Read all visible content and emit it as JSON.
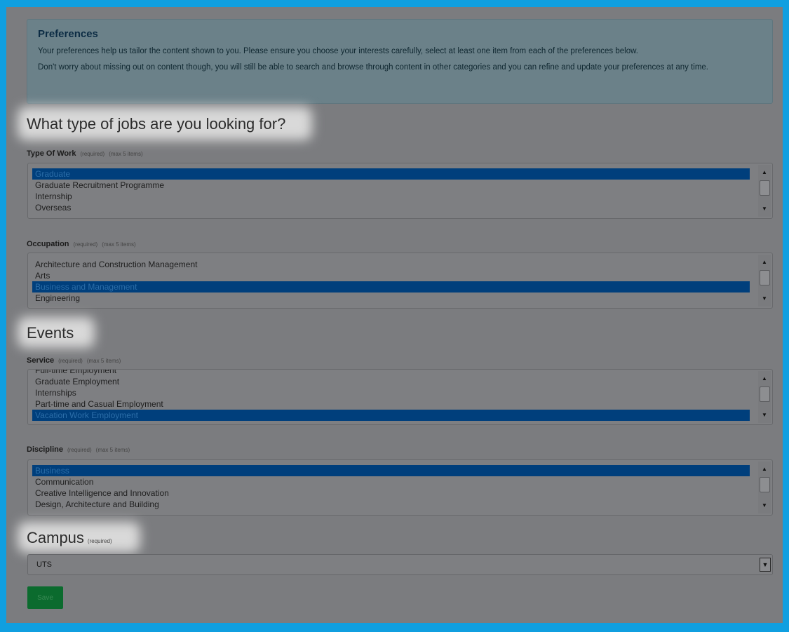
{
  "preferences": {
    "title": "Preferences",
    "line1": "Your preferences help us tailor the content shown to you. Please ensure you choose your interests carefully, select at least one item from each of the preferences below.",
    "line2": "Don't worry about missing out on content though, you will still be able to search and browse through content in other categories and you can refine and update your preferences at any time."
  },
  "jobs": {
    "heading": "What type of jobs are you looking for?",
    "type_of_work": {
      "label": "Type Of Work",
      "required": "(required)",
      "max": "(max 5 items)",
      "options": [
        "Graduate",
        "Graduate Recruitment Programme",
        "Internship",
        "Overseas"
      ],
      "selected": [
        0
      ]
    },
    "occupation": {
      "label": "Occupation",
      "required": "(required)",
      "max": "(max 5 items)",
      "options": [
        "Architecture and Construction Management",
        "Arts",
        "Business and Management",
        "Engineering"
      ],
      "selected": [
        2
      ]
    }
  },
  "events": {
    "heading": "Events",
    "service": {
      "label": "Service",
      "required": "(required)",
      "max": "(max 5 items)",
      "options": [
        "Full-time Employment",
        "Graduate Employment",
        "Internships",
        "Part-time and Casual Employment",
        "Vacation Work Employment"
      ],
      "selected": [
        4
      ]
    },
    "discipline": {
      "label": "Discipline",
      "required": "(required)",
      "max": "(max 5 items)",
      "options": [
        "Business",
        "Communication",
        "Creative Intelligence and Innovation",
        "Design, Architecture and Building"
      ],
      "selected": [
        0
      ]
    }
  },
  "campus": {
    "heading": "Campus",
    "required": "(required)",
    "value": "UTS"
  },
  "save_label": "Save",
  "colors": {
    "frame": "#109fe0",
    "overlay": "#7b7c7f",
    "selected_option": "#003f7c",
    "save_button": "#0b6b2e"
  }
}
